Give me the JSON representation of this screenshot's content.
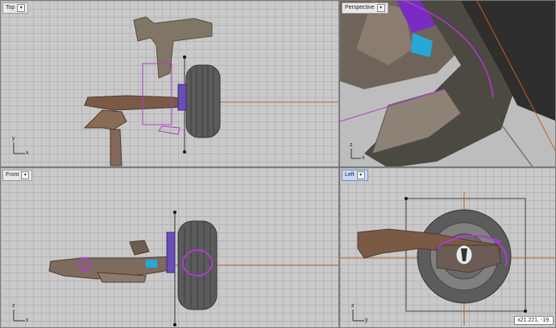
{
  "viewports": {
    "top": {
      "label": "Top"
    },
    "perspective": {
      "label": "Perspective"
    },
    "front": {
      "label": "Front"
    },
    "left": {
      "label": "Left"
    }
  },
  "axes": {
    "x": "x",
    "y": "y",
    "z": "z"
  },
  "dropdown_glyph": "▾",
  "status": {
    "coordinates": "x21.221, -19."
  },
  "colors": {
    "grid_bg": "#c9c9c9",
    "x_axis": "#c0622b",
    "selection": "#b13ad0",
    "rust": "#7b5a45",
    "tire": "#5b5b5b",
    "active_tab": "#c7dcf2"
  }
}
